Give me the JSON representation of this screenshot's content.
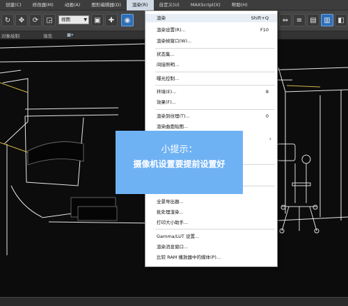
{
  "menubar": {
    "items": [
      "创建(C)",
      "修改器(M)",
      "动画(A)",
      "图形编辑器(D)",
      "渲染(R)",
      "自定义(U)",
      "MAXScript(X)",
      "帮助(H)"
    ]
  },
  "toolbar": {
    "view_select": "视图"
  },
  "subbar": {
    "label_left": "对象绘制",
    "label_mid": "填充"
  },
  "render_menu": {
    "items": [
      {
        "label": "渲染",
        "shortcut": "Shift+Q"
      },
      {
        "label": "渲染设置(R)...",
        "shortcut": "F10"
      },
      {
        "label": "渲染帧窗口(W)...",
        "shortcut": ""
      },
      {
        "label": "状态集...",
        "shortcut": ""
      },
      {
        "label": "间接照明...",
        "shortcut": ""
      },
      {
        "label": "曝光控制...",
        "shortcut": ""
      },
      {
        "label": "环境(E)...",
        "shortcut": "8"
      },
      {
        "label": "效果(F)...",
        "shortcut": ""
      },
      {
        "label": "渲染到纹理(T)...",
        "shortcut": "0"
      },
      {
        "label": "渲染曲面贴图...",
        "shortcut": ""
      },
      {
        "label": "全景导出器...",
        "shortcut": ""
      },
      {
        "label": "批处理渲染...",
        "shortcut": ""
      },
      {
        "label": "打印大小助手...",
        "shortcut": ""
      },
      {
        "label": "Gamma/LUT 设置...",
        "shortcut": ""
      },
      {
        "label": "渲染消息窗口...",
        "shortcut": ""
      },
      {
        "label": "比较 RAM 播放器中的媒体(P)...",
        "shortcut": ""
      }
    ]
  },
  "tip": {
    "title": "小提示：",
    "body": "摄像机设置要提前设置好"
  },
  "colors": {
    "tip_bg": "#6fb2f4",
    "menu_active": "#cfd9e6"
  }
}
